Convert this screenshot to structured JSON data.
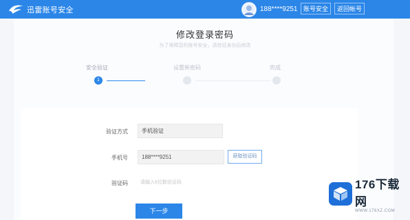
{
  "header": {
    "logo_text": "迅雷账号安全",
    "phone": "188****9251",
    "security_button": "账号安全",
    "back_button": "返回帐号"
  },
  "page": {
    "title": "修改登录密码",
    "subtitle": "为了保障您的账号安全，请验证身份后修改"
  },
  "steps": [
    {
      "label": "安全验证",
      "number": "1",
      "active": true
    },
    {
      "label": "设置新密码",
      "number": "",
      "active": false
    },
    {
      "label": "完成",
      "number": "",
      "active": false
    }
  ],
  "form": {
    "method_label": "验证方式",
    "method_value": "手机验证",
    "phone_label": "手机号",
    "phone_value": "188****9251",
    "get_code_button": "获取验证码",
    "code_label": "验证码",
    "code_placeholder": "请输入6位数验证码",
    "next_button": "下一步"
  },
  "watermark": {
    "main": "176下载网",
    "sub": "WWW.176XZ.COM"
  },
  "colors": {
    "brand": "#2b86e8",
    "background": "#f4f6fa"
  }
}
